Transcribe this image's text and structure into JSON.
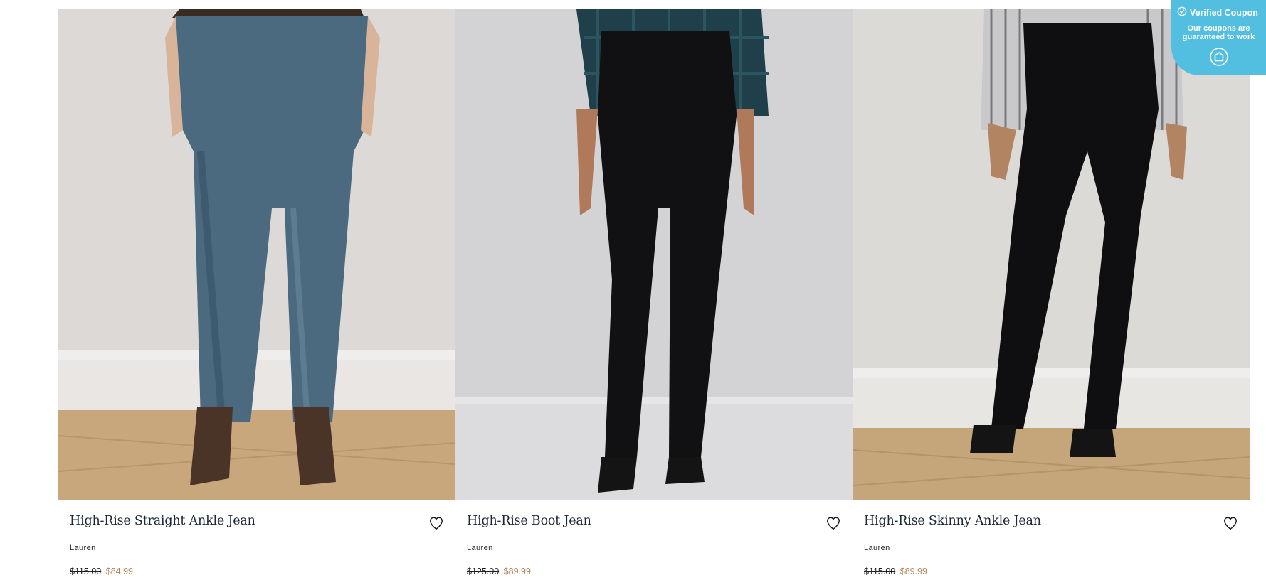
{
  "products": [
    {
      "title": "High-Rise Straight Ankle Jean",
      "brand": "Lauren",
      "original_price": "$115.00",
      "sale_price": "$84.99"
    },
    {
      "title": "High-Rise Boot Jean",
      "brand": "Lauren",
      "original_price": "$125.00",
      "sale_price": "$89.99"
    },
    {
      "title": "High-Rise Skinny Ankle Jean",
      "brand": "Lauren",
      "original_price": "$115.00",
      "sale_price": "$89.99"
    }
  ],
  "coupon_badge": {
    "heading": "Verified Coupon",
    "subtext": "Our coupons are guaranteed to work",
    "check_icon": "check-circle-icon",
    "action_icon": "coupon-logo-icon"
  },
  "icons": {
    "favorite": "heart-outline-icon"
  },
  "colors": {
    "title": "#1b2838",
    "sale_price": "#b08257",
    "coupon_background": "#52bfe0"
  }
}
